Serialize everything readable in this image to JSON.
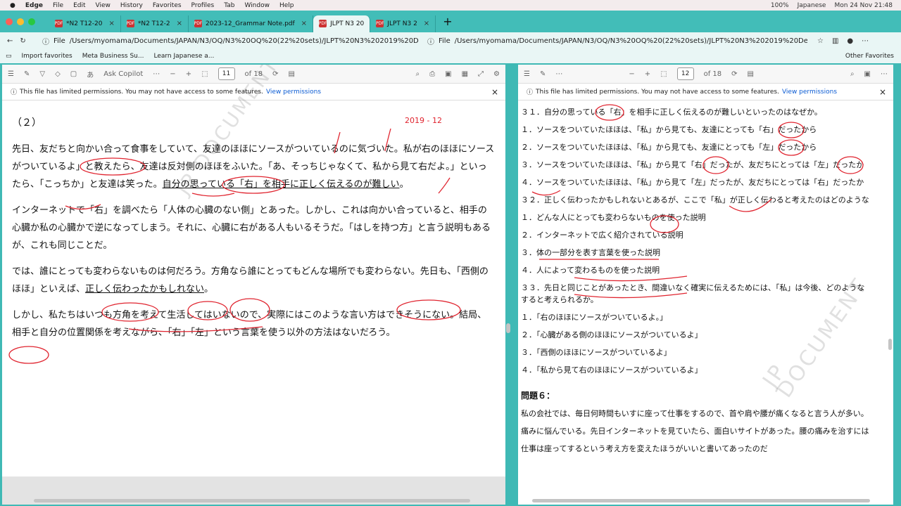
{
  "menubar": {
    "app": "Edge",
    "items": [
      "File",
      "Edit",
      "View",
      "History",
      "Favorites",
      "Profiles",
      "Tab",
      "Window",
      "Help"
    ],
    "battery": "100%",
    "input": "Japanese",
    "clock": "Mon 24 Nov  21:48"
  },
  "tabs": [
    {
      "label": "*N2 T12-20"
    },
    {
      "label": "*N2 T12-2"
    },
    {
      "label": "2023-12_Grammar Note.pdf"
    },
    {
      "label": "JLPT N3 20"
    },
    {
      "label": "JLPT N3 2"
    }
  ],
  "address": {
    "left_scheme": "File",
    "left_url": "/Users/myomama/Documents/JAPAN/N3/OQ/N3%20OQ%20(22%20sets)/JLPT%20N3%202019%20December...",
    "right_scheme": "File",
    "right_url": "/Users/myomama/Documents/JAPAN/N3/OQ/N3%20OQ%20(22%20sets)/JLPT%20N3%202019%20Decemb..."
  },
  "bookmarks": [
    "Import favorites",
    "Meta Business Su...",
    "Learn Japanese a..."
  ],
  "other_favorites": "Other Favorites",
  "left_pdf": {
    "copilot": "Ask Copilot",
    "page": "11",
    "of": "of 18",
    "permission": "This file has limited permissions. You may not have access to some features.",
    "permission_link": "View permissions",
    "date_note": "2019 - 12",
    "watermark": "JP DOCUMENT",
    "heading": "（２）",
    "p1a": "先日、友だちと向かい合って食事をしていて、友達のほほにソースがついているのに気づいた。私が右のほほにソースがついているよ」と教えたら、友達は反対側のほほをふいた。「あ、そっちじゃなくて、私から見て右だよ。」といったら、「こっちか」と友達は笑った。",
    "p1b": "自分の思っている「右」を相手に正しく伝えるのが難しい",
    "p1c": "。",
    "p2": "インターネットで「右」を調べたら「人体の心臓のない側」とあった。しかし、これは向かい合っていると、相手の心臓か私の心臓かで逆になってしまう。それに、心臓に右がある人もいるそうだ。「はしを持つ方」と言う説明もあるが、これも同じことだ。",
    "p3a": "では、誰にとっても変わらないものは何だろう。方角なら誰にとってもどんな場所でも変わらない。先日も、「西側のほほ」といえば、",
    "p3b": "正しく伝わったかもしれない",
    "p3c": "。",
    "p4": "しかし、私たちはいつも方角を考えて生活してはいないので、実際にはこのような言い方はできそうにない。結局、相手と自分の位置関係を考えながら、「右」「左」という言葉を使う以外の方法はないだろう。"
  },
  "right_pdf": {
    "page": "12",
    "of": "of 18",
    "permission": "This file has limited permissions. You may not have access to some features.",
    "permission_link": "View permissions",
    "watermark": "JP DOCUMENT",
    "q31": "３１．自分の思っている「右」を相手に正しく伝えるのが難しいといったのはなぜか。",
    "q31_opts": [
      "１．ソースをついていたほほは、「私」から見ても、友達にとっても「右」だったから",
      "２．ソースをついていたほほは、「私」から見ても、友達にとっても「左」だったから",
      "３．ソースをついていたほほは、「私」から見て「右」だったが、友だちにとっては「左」だったか",
      "４．ソースをついていたほほは、「私」から見て「左」だったが、友だちにとっては「右」だったか"
    ],
    "q32": "３２．正しく伝わったかもしれないとあるが、ここで「私」が正しく伝わると考えたのはどのような",
    "q32_opts": [
      "１．どんな人にとっても変わらないものを使った説明",
      "２．インターネットで広く紹介されている説明",
      "３．体の一部分を表す言葉を使った説明",
      "４．人によって変わるものを使った説明"
    ],
    "q33a": "３３．先日と同じことがあったとき、間違いなく確実に伝えるためには、「私」は今後、どのような",
    "q33b": "すると考えられるか。",
    "q33_opts": [
      "１．「右のほほにソースがついているよ。」",
      "２．「心臓がある側のほほにソースがついているよ」",
      "３．「西側のほほにソースがついているよ」",
      "４．「私から見て右のほほにソースがついているよ」"
    ],
    "section": "問題６：",
    "s1": "私の会社では、毎日何時間もいすに座って仕事をするので、首や肩や腰が痛くなると言う人が多い。",
    "s2": "痛みに悩んでいる。先日インターネットを見ていたら、面白いサイトがあった。腰の痛みを治すには",
    "s3": "仕事は座ってするという考え方を変えたほうがいいと書いてあったのだ"
  },
  "colors": {
    "teal": "#42bdb8",
    "ink": "#e0242f",
    "link": "#0b5bd3"
  }
}
